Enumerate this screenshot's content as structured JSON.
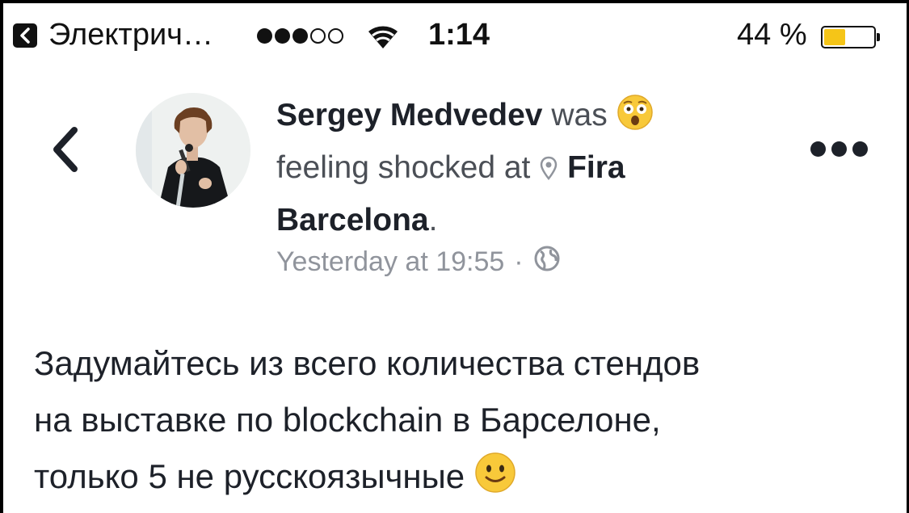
{
  "status_bar": {
    "back_app_label": "Электрич…",
    "signal": {
      "filled": 3,
      "total": 5
    },
    "time": "1:14",
    "battery_percent_text": "44 %",
    "battery_level": 0.44,
    "battery_color": "#f5c518"
  },
  "post": {
    "author": "Sergey Medvedev",
    "was": "was",
    "feeling_text": "feeling shocked at",
    "place_line1": "Fira",
    "place_line2": "Barcelona",
    "period": ".",
    "timestamp": "Yesterday at 19:55",
    "separator": "·",
    "audience_icon": "globe-icon",
    "feeling_icon": "shocked-face-emoji",
    "location_icon": "map-pin-icon",
    "body_lines": [
      "Задумайтесь из всего количества стендов",
      "на выставке по blockchain в Барселоне,",
      "только 5 не русскоязычные"
    ],
    "body_emoji": "slightly-smiling-face-emoji"
  },
  "colors": {
    "primary_text": "#1d2129",
    "secondary_text": "#4b4f56",
    "meta_text": "#90949c",
    "emoji_yellow": "#f8c93a"
  }
}
